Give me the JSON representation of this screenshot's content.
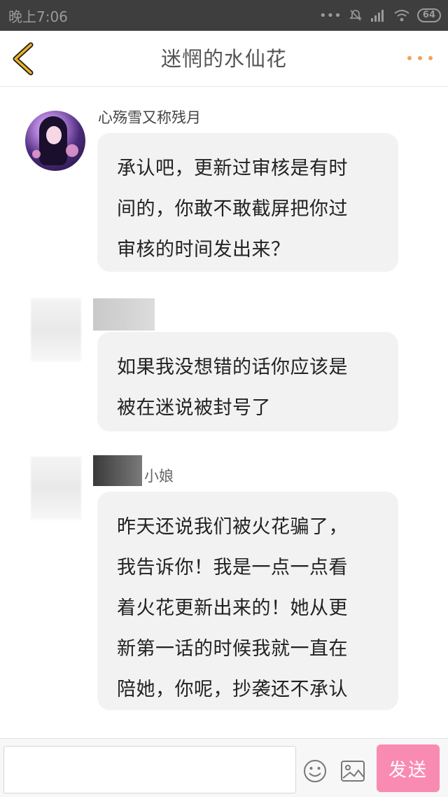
{
  "status_bar": {
    "time": "晚上7:06",
    "battery": "64"
  },
  "header": {
    "title": "迷惘的水仙花"
  },
  "messages": [
    {
      "sender": "心殇雪又称残月",
      "text_lines": [
        "承认吧，更新过审核是有时",
        "间的，你敢不敢截屏把你过",
        "审核的时间发出来？"
      ]
    },
    {
      "sender": "",
      "text_lines": [
        "如果我没想错的话你应该是",
        "被在迷说被封号了"
      ]
    },
    {
      "sender": "小娘",
      "text_lines": [
        "昨天还说我们被火花骗了，",
        "我告诉你！我是一点一点看",
        "着火花更新出来的！她从更",
        "新第一话的时候我就一直在",
        "陪她，你呢，抄袭还不承认"
      ]
    }
  ],
  "input_bar": {
    "placeholder": "",
    "send_label": "发送"
  },
  "colors": {
    "accent_back": "#f0b323",
    "more_dots": "#f0a35a",
    "send_button": "#f98bb2"
  },
  "icons": [
    "back-arrow-icon",
    "more-dots-icon",
    "emoji-icon",
    "image-icon",
    "signal-icon",
    "wifi-icon",
    "mute-icon"
  ]
}
